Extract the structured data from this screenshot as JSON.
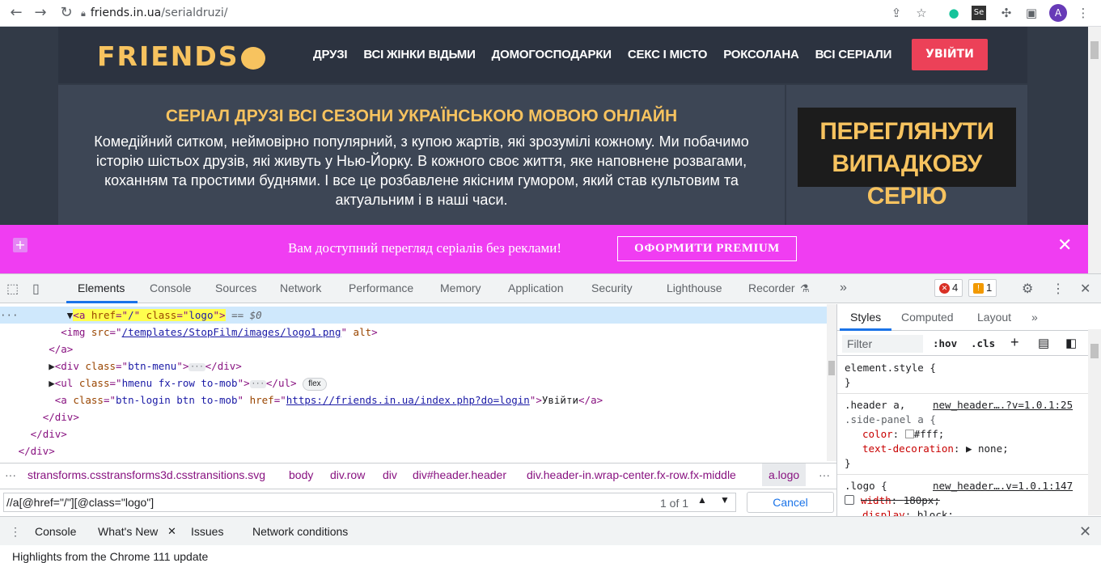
{
  "browser": {
    "url_host": "friends.in.ua",
    "url_path": "/serialdruzi/",
    "avatar_letter": "A"
  },
  "site": {
    "logo_text": "FRIENDS",
    "menu": [
      "ДРУЗІ",
      "ВСІ ЖІНКИ ВІДЬМИ",
      "ДОМОГОСПОДАРКИ",
      "СЕКС І МІСТО",
      "РОКСОЛАНА",
      "ВСІ СЕРІАЛИ"
    ],
    "login_label": "УВІЙТИ",
    "hero_title": "СЕРІАЛ ДРУЗІ ВСІ СЕЗОНИ УКРАЇНСЬКОЮ МОВОЮ ОНЛАЙН",
    "hero_text": "Комедійний ситком, неймовірно популярний, з купою жартів, які зрозумілі кожному. Ми побачимо історію шістьох друзів, які живуть у Нью-Йорку. В кожного своє життя, яке наповнене розвагами, коханням та простими буднями. І все це розбавлене якісним гумором, який став культовим та актуальним і в наші часи.",
    "random_button": "ПЕРЕГЛЯНУТИ ВИПАДКОВУ СЕРІЮ"
  },
  "banner": {
    "text": "Вам доступний перегляд серіалів без реклами!",
    "button": "ОФОРМИТИ PREMIUM"
  },
  "devtools": {
    "tabs": [
      "Elements",
      "Console",
      "Sources",
      "Network",
      "Performance",
      "Memory",
      "Application",
      "Security",
      "Lighthouse",
      "Recorder"
    ],
    "errors": "4",
    "warnings": "1",
    "elements": {
      "selected_suffix": "== $0",
      "img_src": "/templates/StopFilm/images/logo1.png",
      "login_href": "https://friends.in.ua/index.php?do=login",
      "login_text": "Увійти",
      "flex_pill": "flex"
    },
    "breadcrumbs": [
      "stransforms.csstransforms3d.csstransitions.svg",
      "body",
      "div.row",
      "div",
      "div#header.header",
      "div.header-in.wrap-center.fx-row.fx-middle",
      "a.logo"
    ],
    "search": {
      "query": "//a[@href=\"/\"][@class=\"logo\"]",
      "match": "1 of 1",
      "cancel": "Cancel"
    },
    "styles": {
      "tabs": [
        "Styles",
        "Computed",
        "Layout"
      ],
      "filter_placeholder": "Filter",
      "hov": ":hov",
      "cls": ".cls",
      "element_style": "element.style {",
      "rule1_selector_a": ".header a,",
      "rule1_selector_b": ".side-panel a {",
      "rule1_source": "new_header….?v=1.0.1:25",
      "rule1_prop1": "color",
      "rule1_val1": "#fff;",
      "rule1_prop2": "text-decoration",
      "rule1_val2": "none;",
      "rule2_selector": ".logo {",
      "rule2_source": "new_header….v=1.0.1:147",
      "rule2_prop1": "width",
      "rule2_val1": "180px;",
      "rule2_prop2": "display",
      "rule2_val2": "block;"
    },
    "drawer": {
      "tabs": [
        "Console",
        "What's New",
        "Issues",
        "Network conditions"
      ],
      "body_text": "Highlights from the Chrome 111 update"
    }
  }
}
